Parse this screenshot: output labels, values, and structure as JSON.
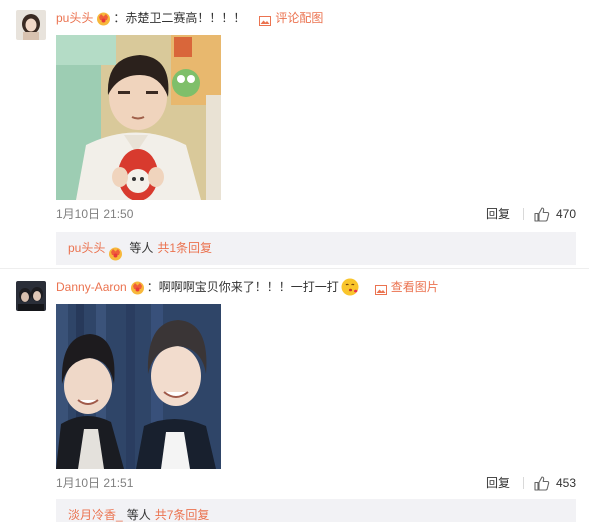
{
  "comments": [
    {
      "username": "pu头头",
      "colon": "：",
      "text": "赤楚卫二赛高！！！！",
      "pic_link": "评论配图",
      "date": "1月10日 21:50",
      "reply_label": "回复",
      "like_count": "470",
      "sub_reply": {
        "user": "pu头头",
        "text": "等人",
        "more": "共1条回复"
      }
    },
    {
      "username": "Danny-Aaron",
      "colon": "：",
      "text": "啊啊啊宝贝你来了！！！一打一打",
      "pic_link": "查看图片",
      "date": "1月10日 21:51",
      "reply_label": "回复",
      "like_count": "453",
      "sub_reply": {
        "user": "淡月冷香_",
        "text": "等人",
        "more": "共7条回复"
      }
    }
  ],
  "icons": {
    "vip_badge": "crown-badge-icon",
    "picture": "picture-icon",
    "like": "thumbs-up-icon",
    "emoji": "kiss-face-emoji-icon"
  },
  "colors": {
    "accent": "#eb7350",
    "sub_box_bg": "#f2f2f5",
    "date_gray": "#808080"
  }
}
